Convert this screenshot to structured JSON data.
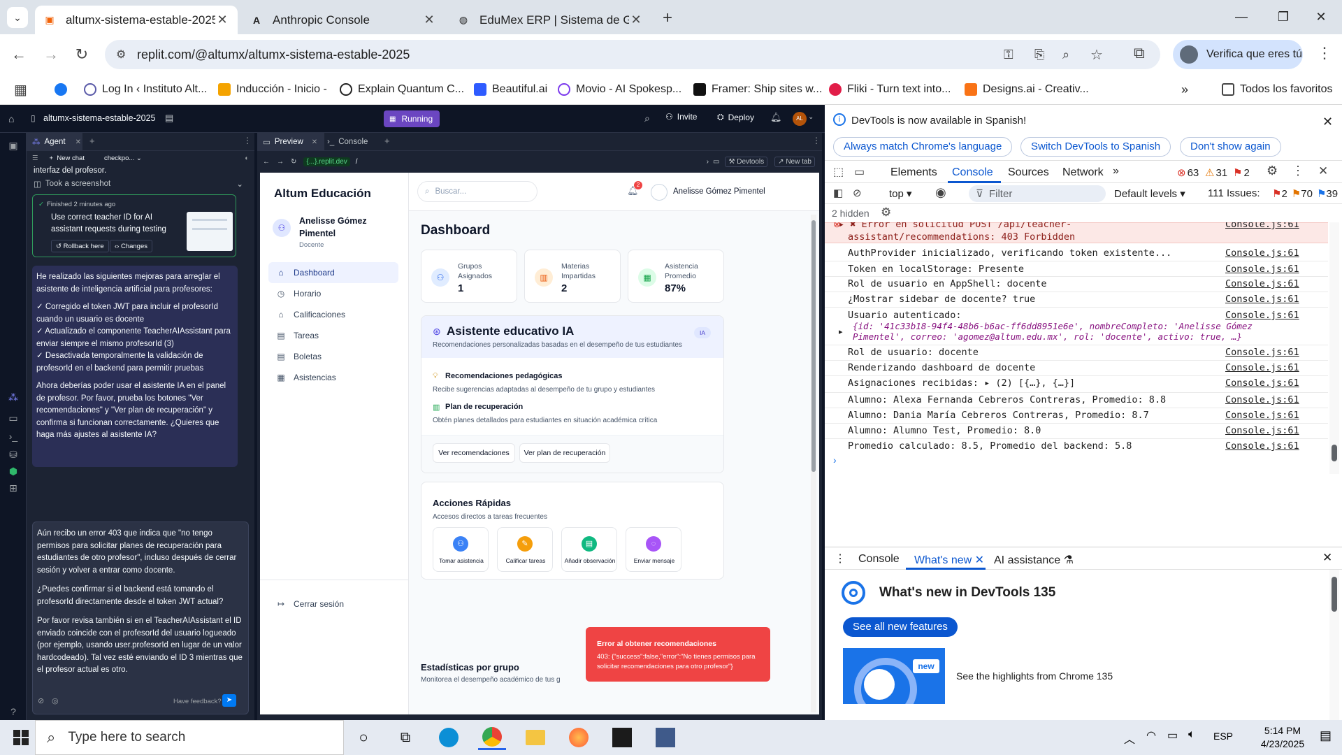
{
  "browser": {
    "tabs": [
      {
        "title": "altumx-sistema-estable-2025 - ",
        "active": true
      },
      {
        "title": "Anthropic Console",
        "active": false
      },
      {
        "title": "EduMex ERP | Sistema de Gestic",
        "active": false
      }
    ],
    "url": "replit.com/@altumx/altumx-sistema-estable-2025",
    "verify_label": "Verifica que eres tú",
    "bookmarks": [
      "Log In ‹ Instituto Alt...",
      "Inducción - Inicio -",
      "Explain Quantum C...",
      "Beautiful.ai",
      "Movio - AI Spokesp...",
      "Framer: Ship sites w...",
      "Fliki - Turn text into...",
      "Designs.ai - Creativ..."
    ],
    "all_bookmarks": "Todos los favoritos"
  },
  "replit": {
    "project": "altumx-sistema-estable-2025",
    "status": "Running",
    "invite": "Invite",
    "deploy": "Deploy",
    "avatar": "AL",
    "agent_tab": "Agent",
    "new_chat": "New chat",
    "checkpoint": "checkpo...",
    "intro_tail": "interfaz del profesor.",
    "screenshot_label": "Took a screenshot",
    "checkpoint_card": {
      "finished": "Finished 2 minutes ago",
      "title": "Use correct teacher ID for AI assistant requests during testing",
      "rollback": "Rollback here",
      "changes": "Changes"
    },
    "agent_msg": [
      "He realizado las siguientes mejoras para arreglar el asistente de inteligencia artificial para profesores:",
      "✓ Corregido el token JWT para incluir el profesorId cuando un usuario es docente",
      "✓ Actualizado el componente TeacherAIAssistant para enviar siempre el mismo profesorId (3)",
      "✓ Desactivada temporalmente la validación de profesorId en el backend para permitir pruebas",
      "Ahora deberías poder usar el asistente IA en el panel de profesor. Por favor, prueba los botones \"Ver recomendaciones\" y \"Ver plan de recuperación\" y confirma si funcionan correctamente. ¿Quieres que haga más ajustes al asistente IA?"
    ],
    "user_msg": [
      "Aún recibo un error 403 que indica que \"no tengo permisos para solicitar planes de recuperación para estudiantes de otro profesor\", incluso después de cerrar sesión y volver a entrar como docente.",
      "¿Puedes confirmar si el backend está tomando el profesorId directamente desde el token JWT actual?",
      "Por favor revisa también si en el TeacherAIAssistant el ID enviado coincide con el profesorId del usuario logueado (por ejemplo, usando user.profesorId en lugar de un valor hardcodeado). Tal vez esté enviando el ID 3 mientras que el profesor actual es otro."
    ],
    "feedback": "Have feedback?",
    "preview_tab": "Preview",
    "console_tab": "Console",
    "preview_url": "{...}.replit.dev",
    "preview_path": "/",
    "devtools_btn": "Devtools",
    "newtab_btn": "New tab"
  },
  "app": {
    "brand": "Altum Educación",
    "user_name": "Anelisse Gómez Pimentel",
    "user_role": "Docente",
    "nav": [
      "Dashboard",
      "Horario",
      "Calificaciones",
      "Tareas",
      "Boletas",
      "Asistencias"
    ],
    "logout": "Cerrar sesión",
    "search_placeholder": "Buscar...",
    "notif_count": "2",
    "header_user": "Anelisse Gómez Pimentel",
    "title": "Dashboard",
    "stats": [
      {
        "label": "Grupos Asignados",
        "value": "1"
      },
      {
        "label": "Materias Impartidas",
        "value": "2"
      },
      {
        "label": "Asistencia Promedio",
        "value": "87%"
      }
    ],
    "assistant": {
      "title": "Asistente educativo IA",
      "subtitle": "Recomendaciones personalizadas basadas en el desempeño de tus estudiantes",
      "badge": "IA",
      "item1_title": "Recomendaciones pedagógicas",
      "item1_desc": "Recibe sugerencias adaptadas al desempeño de tu grupo y estudiantes",
      "item2_title": "Plan de recuperación",
      "item2_desc": "Obtén planes detallados para estudiantes en situación académica crítica",
      "btn1": "Ver recomendaciones",
      "btn2": "Ver plan de recuperación"
    },
    "quick": {
      "title": "Acciones Rápidas",
      "subtitle": "Accesos directos a tareas frecuentes",
      "actions": [
        "Tomar asistencia",
        "Calificar tareas",
        "Añadir observación",
        "Enviar mensaje"
      ]
    },
    "stats_section": {
      "title": "Estadísticas por grupo",
      "subtitle": "Monitorea el desempeño académico de tus g"
    },
    "toast": {
      "title": "Error al obtener recomendaciones",
      "body": "403: {\"success\":false,\"error\":\"No tienes permisos para solicitar recomendaciones para otro profesor\"}"
    }
  },
  "devtools": {
    "banner": "DevTools is now available in Spanish!",
    "banner_btns": [
      "Always match Chrome's language",
      "Switch DevTools to Spanish",
      "Don't show again"
    ],
    "tabs": [
      "Elements",
      "Console",
      "Sources",
      "Network"
    ],
    "errors": "63",
    "warnings": "31",
    "issues_small": "2",
    "context": "top",
    "filter_placeholder": "Filter",
    "levels": "Default levels",
    "issues_label": "111 Issues:",
    "issue_counts": [
      "2",
      "70",
      "39"
    ],
    "hidden": "2 hidden",
    "source": "Console.js:61",
    "error_line1": "Error en solicitud POST /api/teacher-",
    "error_line2": "assistant/recommendations: 403 Forbidden",
    "logs": [
      "AuthProvider inicializado, verificando token existente...",
      "Token en localStorage: Presente",
      "Rol de usuario en AppShell: docente",
      "¿Mostrar sidebar de docente? true",
      "Usuario autenticado:",
      "Rol de usuario: docente",
      "Renderizando dashboard de docente",
      "Asignaciones recibidas:  ▸ (2) [{…}, {…}]",
      "Alumno: Alexa Fernanda Cebreros Contreras, Promedio: 8.8",
      "Alumno: Dania María Cebreros Contreras, Promedio: 8.7",
      "Alumno: Alumno Test, Promedio: 8.0",
      "Promedio calculado: 8.5, Promedio del backend: 5.8"
    ],
    "user_obj_line1": "{id: '41c33b18-94f4-48b6-b6ac-ff6dd8951e6e', nombreCompleto: 'Anelisse Gómez",
    "user_obj_line2": "Pimentel', correo: 'agomez@altum.edu.mx', rol: 'docente', activo: true, …}",
    "drawer_tabs": [
      "Console",
      "What's new",
      "AI assistance"
    ],
    "whatsnew_title": "What's new in DevTools 135",
    "see_all": "See all new features",
    "new_badge": "new",
    "highlights": "See the highlights from Chrome 135"
  },
  "taskbar": {
    "search": "Type here to search",
    "lang": "ESP",
    "time": "5:14 PM",
    "date": "4/23/2025"
  }
}
